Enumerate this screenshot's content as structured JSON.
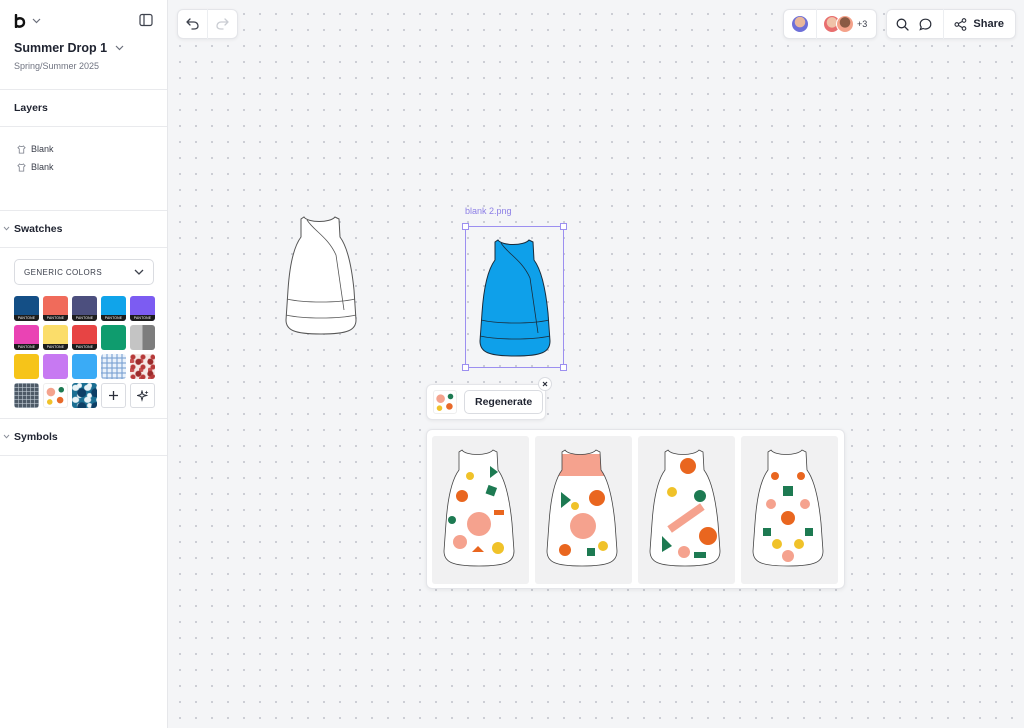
{
  "app": {
    "logo": "b-logo-icon"
  },
  "project": {
    "title": "Summer Drop 1",
    "subtitle": "Spring/Summer 2025"
  },
  "layers": {
    "heading": "Layers",
    "items": [
      {
        "label": "Blank"
      },
      {
        "label": "Blank"
      }
    ]
  },
  "swatches": {
    "heading": "Swatches",
    "dropdown_value": "GENERIC COLORS",
    "pantone_tag": "PANTONE",
    "colors": [
      "#144f86",
      "#f06b5b",
      "#4c4f7e",
      "#10a4ea",
      "#7c5cf2",
      "#ea43b4",
      "#fbdd6a",
      "#e74444",
      "#0f9c6e",
      "#a9a9a9",
      "#f6c419",
      "#c779f2",
      "#3aabf6"
    ]
  },
  "symbols": {
    "heading": "Symbols"
  },
  "toolbar": {
    "undo": "undo-icon",
    "redo": "redo-icon"
  },
  "collab": {
    "extra_count": "+3"
  },
  "actions": {
    "share_label": "Share"
  },
  "canvas": {
    "selected_file": "blank 2.png",
    "regenerate_label": "Regenerate",
    "accent": "#9c8ff0",
    "garment_fill": "#0ea0ea"
  },
  "results": {
    "count": 4
  }
}
